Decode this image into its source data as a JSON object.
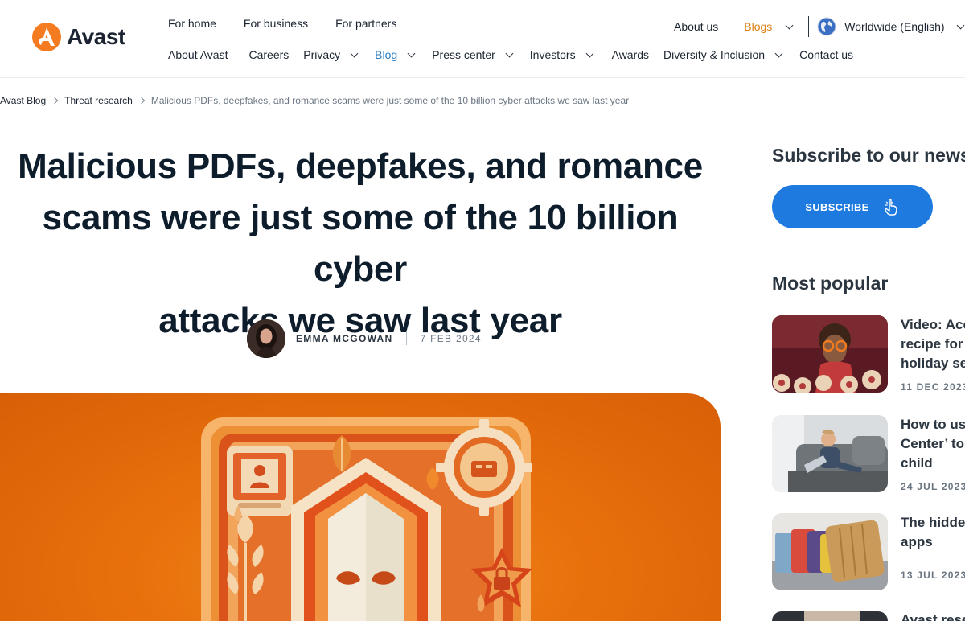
{
  "header": {
    "logo_text": "Avast",
    "top_nav": [
      "For home",
      "For business",
      "For partners"
    ],
    "about_us": "About us",
    "blogs": "Blogs",
    "locale": "Worldwide (English)",
    "sub_nav": [
      {
        "label": "About Avast",
        "dropdown": false
      },
      {
        "label": "Careers",
        "dropdown": false
      },
      {
        "label": "Privacy",
        "dropdown": true
      },
      {
        "label": "Blog",
        "dropdown": true,
        "active": true
      },
      {
        "label": "Press center",
        "dropdown": true
      },
      {
        "label": "Investors",
        "dropdown": true
      },
      {
        "label": "Awards",
        "dropdown": false
      },
      {
        "label": "Diversity & Inclusion",
        "dropdown": true
      },
      {
        "label": "Contact us",
        "dropdown": false
      }
    ]
  },
  "breadcrumb": {
    "root": "Avast Blog",
    "category": "Threat research",
    "current": "Malicious PDFs, deepfakes, and romance scams were just some of the 10 billion cyber attacks we saw last year"
  },
  "article": {
    "title_lines": [
      "Malicious PDFs, deepfakes, and romance",
      "scams were just some of the 10 billion cyber",
      "attacks we saw last year"
    ],
    "author": "EMMA MCGOWAN",
    "date": "7 FEB 2024"
  },
  "sidebar": {
    "subscribe_heading": "Subscribe to our newsl",
    "subscribe_button": "SUBSCRIBE",
    "most_popular_heading": "Most popular",
    "items": [
      {
        "title_lines": [
          "Video: Acc",
          "recipe for",
          "holiday se"
        ],
        "date": "11 DEC 2023"
      },
      {
        "title_lines": [
          "How to us",
          "Center’ to",
          "child"
        ],
        "date": "24 JUL 2023"
      },
      {
        "title_lines": [
          "The hidder",
          "apps"
        ],
        "date": "13 JUL 2023"
      },
      {
        "title_lines": [
          "Avast rese"
        ],
        "date": ""
      }
    ]
  },
  "colors": {
    "accent_orange": "#e07d10",
    "link_blue": "#2a7bbf",
    "subscribe_blue": "#1f7ae0",
    "hero_orange": "#e8700c"
  }
}
